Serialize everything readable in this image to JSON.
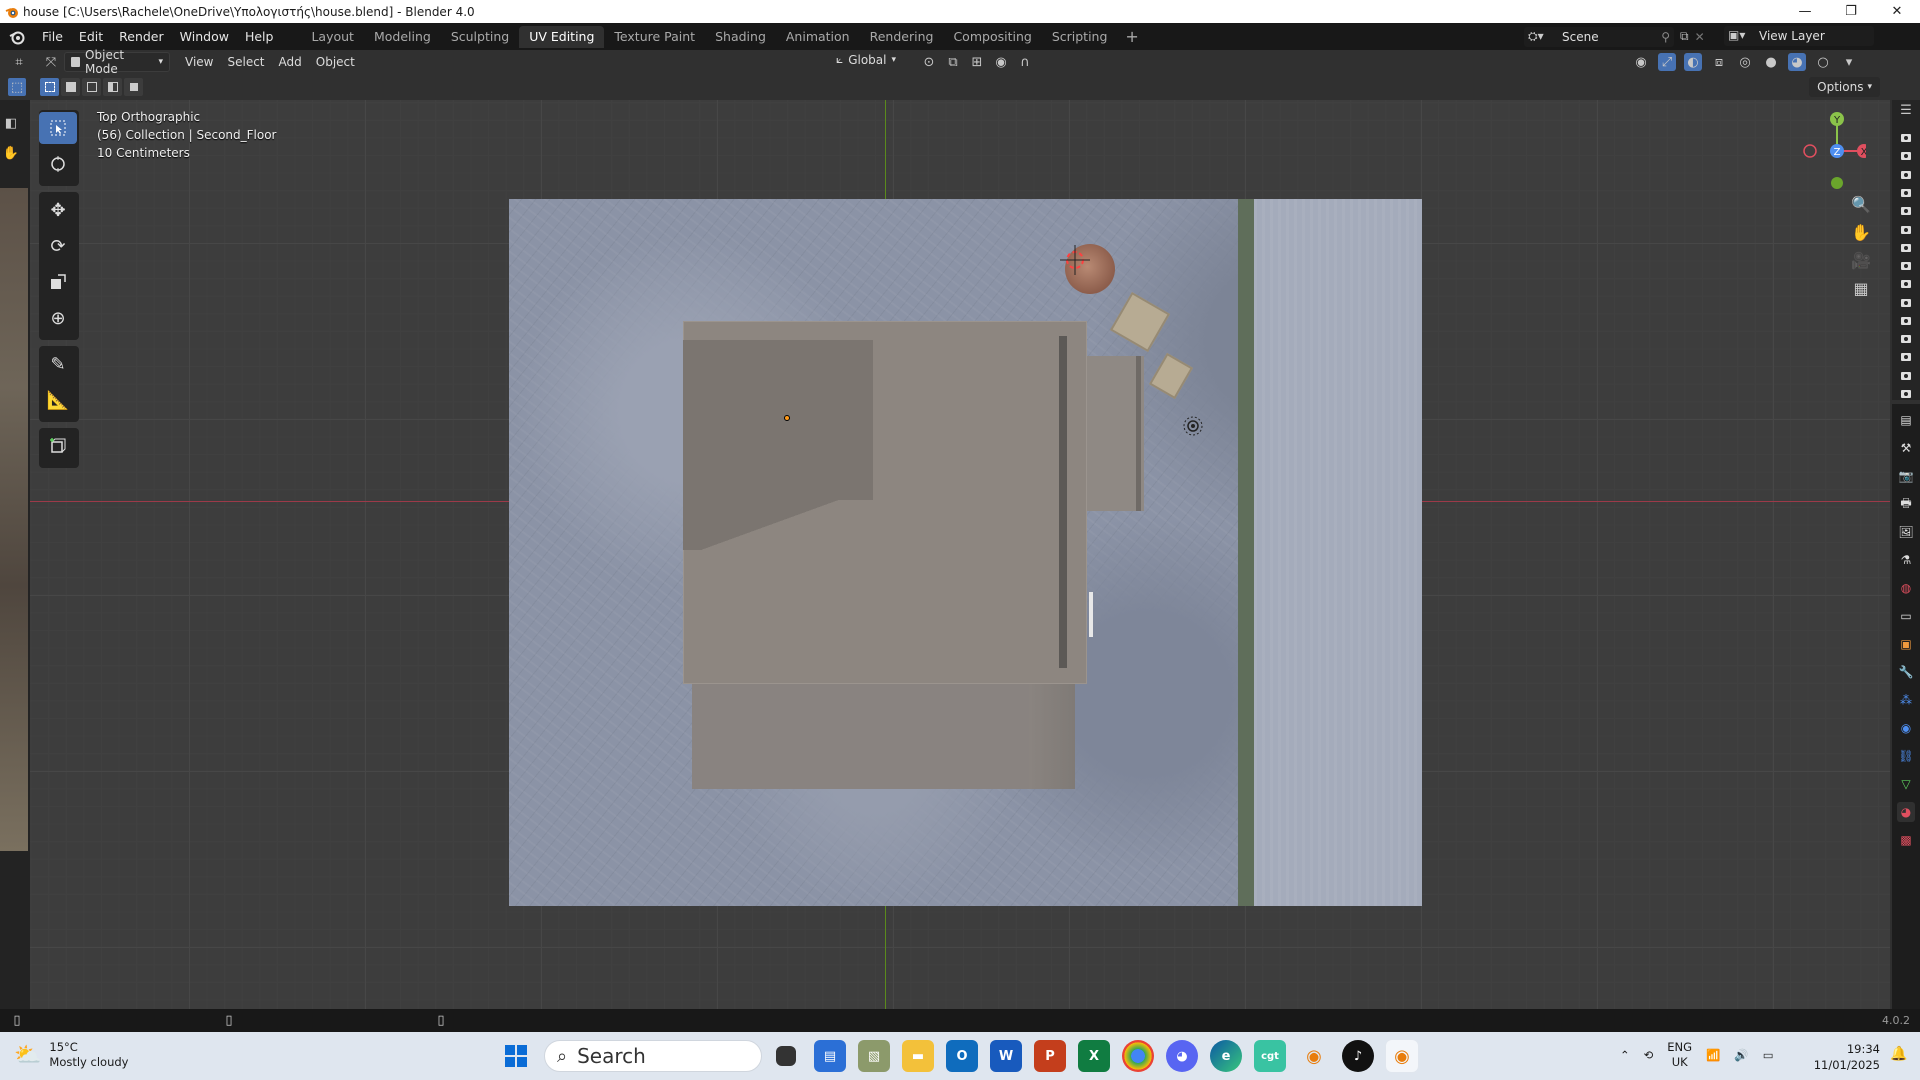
{
  "window": {
    "title": "house [C:\\Users\\Rachele\\OneDrive\\Υπολογιστής\\house.blend] - Blender 4.0",
    "controls": [
      "—",
      "❐",
      "✕"
    ]
  },
  "menu": [
    "File",
    "Edit",
    "Render",
    "Window",
    "Help"
  ],
  "workspaces": [
    {
      "label": "Layout",
      "active": false
    },
    {
      "label": "Modeling",
      "active": false
    },
    {
      "label": "Sculpting",
      "active": false
    },
    {
      "label": "UV Editing",
      "active": true
    },
    {
      "label": "Texture Paint",
      "active": false
    },
    {
      "label": "Shading",
      "active": false
    },
    {
      "label": "Animation",
      "active": false
    },
    {
      "label": "Rendering",
      "active": false
    },
    {
      "label": "Compositing",
      "active": false
    },
    {
      "label": "Scripting",
      "active": false
    }
  ],
  "scene": {
    "name": "Scene",
    "view_layer": "View Layer"
  },
  "header": {
    "mode": "Object Mode",
    "menus": [
      "View",
      "Select",
      "Add",
      "Object"
    ],
    "orientation": "Global"
  },
  "tool_settings": {
    "options_label": "Options"
  },
  "viewport": {
    "view_name": "Top Orthographic",
    "collection_info": "(56) Collection | Second_Floor",
    "scale": "10 Centimeters"
  },
  "gizmo": {
    "y": "Y",
    "z": "Z",
    "x": "X"
  },
  "status": {
    "version": "4.0.2"
  },
  "taskbar": {
    "weather_temp": "15°C",
    "weather_desc": "Mostly cloudy",
    "search_placeholder": "Search",
    "lang_top": "ENG",
    "lang_bottom": "UK",
    "time": "19:34",
    "date": "11/01/2025"
  },
  "colors": {
    "accent": "#4772b3",
    "axis_x": "#9c3a49",
    "axis_y": "#5b8a1c"
  }
}
